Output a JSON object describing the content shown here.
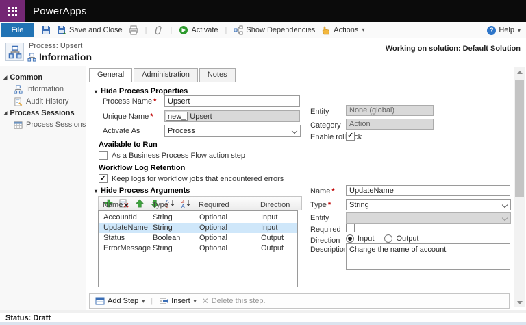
{
  "colors": {
    "brand_purple": "#742774",
    "topbar_black": "#0b0b0b",
    "file_button_blue": "#2173b4",
    "activate_green": "#2d9a2d",
    "selected_row_blue": "#cfe7fa",
    "required_red": "#c00000"
  },
  "icons": {
    "expander": "◢",
    "triangle_down": "▾",
    "caret": "▾",
    "sort": "▼",
    "close": "✕",
    "help_glyph": "?"
  },
  "topbar": {
    "app_name": "PowerApps"
  },
  "command_bar": {
    "file_label": "File",
    "save_and_close_label": "Save and Close",
    "activate_label": "Activate",
    "show_dependencies_label": "Show Dependencies",
    "actions_label": "Actions",
    "help_label": "Help"
  },
  "header": {
    "process_label": "Process: Upsert",
    "title": "Information",
    "working_on": "Working on solution: Default Solution"
  },
  "sidebar": {
    "groups": [
      {
        "label": "Common",
        "items": [
          {
            "label": "Information"
          },
          {
            "label": "Audit History"
          }
        ]
      },
      {
        "label": "Process Sessions",
        "items": [
          {
            "label": "Process Sessions"
          }
        ]
      }
    ]
  },
  "tabs": [
    {
      "label": "General",
      "active": true
    },
    {
      "label": "Administration",
      "active": false
    },
    {
      "label": "Notes",
      "active": false
    }
  ],
  "properties": {
    "section_title": "Hide Process Properties",
    "process_name_label": "Process Name",
    "process_name_value": "Upsert",
    "unique_name_label": "Unique Name",
    "unique_name_prefix": "new_",
    "unique_name_value": "Upsert",
    "activate_as_label": "Activate As",
    "activate_as_value": "Process",
    "entity_label": "Entity",
    "entity_value": "None (global)",
    "category_label": "Category",
    "category_value": "Action",
    "enable_rollback_label": "Enable rollback",
    "enable_rollback_checked": true,
    "available_to_run_label": "Available to Run",
    "bpf_checkbox_label": "As a Business Process Flow action step",
    "bpf_checked": false,
    "log_retention_label": "Workflow Log Retention",
    "keep_logs_label": "Keep logs for workflow jobs that encountered errors",
    "keep_logs_checked": true
  },
  "arguments": {
    "section_title": "Hide Process Arguments",
    "columns": [
      "Name",
      "Type",
      "Required",
      "Direction"
    ],
    "rows": [
      {
        "name": "AccountId",
        "type": "String",
        "required": "Optional",
        "direction": "Input",
        "selected": false
      },
      {
        "name": "UpdateName",
        "type": "String",
        "required": "Optional",
        "direction": "Input",
        "selected": true
      },
      {
        "name": "Status",
        "type": "Boolean",
        "required": "Optional",
        "direction": "Output",
        "selected": false
      },
      {
        "name": "ErrorMessage",
        "type": "String",
        "required": "Optional",
        "direction": "Output",
        "selected": false
      }
    ],
    "detail": {
      "name_label": "Name",
      "name_value": "UpdateName",
      "type_label": "Type",
      "type_value": "String",
      "entity_label": "Entity",
      "entity_value": "",
      "required_label": "Required",
      "required_checked": false,
      "direction_label": "Direction",
      "direction_options": [
        "Input",
        "Output"
      ],
      "direction_value": "Input",
      "description_label": "Description",
      "description_value": "Change the name of account"
    }
  },
  "step_bar": {
    "add_step_label": "Add Step",
    "insert_label": "Insert",
    "delete_label": "Delete this step."
  },
  "status_bar": {
    "label": "Status: Draft"
  }
}
